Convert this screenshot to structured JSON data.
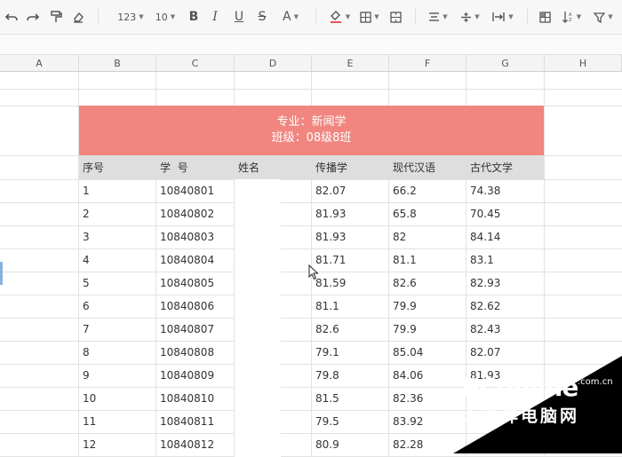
{
  "toolbar": {
    "number_format_label": "123",
    "font_size_label": "10",
    "bold_label": "B",
    "italic_label": "I",
    "underline_label": "U",
    "strike_label": "S",
    "font_color_label": "A"
  },
  "columns": [
    "A",
    "B",
    "C",
    "D",
    "E",
    "F",
    "G",
    "H"
  ],
  "banner": {
    "line1": "专业：新闻学",
    "line2": "班级：08级8班"
  },
  "table": {
    "headers": [
      "序号",
      "学  号",
      "姓名",
      "传播学",
      "现代汉语",
      "古代文学"
    ],
    "rows": [
      [
        "1",
        "10840801",
        "",
        "82.07",
        "66.2",
        "74.38"
      ],
      [
        "2",
        "10840802",
        "",
        "81.93",
        "65.8",
        "70.45"
      ],
      [
        "3",
        "10840803",
        "",
        "81.93",
        "82",
        "84.14"
      ],
      [
        "4",
        "10840804",
        "",
        "81.71",
        "81.1",
        "83.1"
      ],
      [
        "5",
        "10840805",
        "",
        "81.59",
        "82.6",
        "82.93"
      ],
      [
        "6",
        "10840806",
        "",
        "81.1",
        "79.9",
        "82.62"
      ],
      [
        "7",
        "10840807",
        "",
        "82.6",
        "79.9",
        "82.43"
      ],
      [
        "8",
        "10840808",
        "",
        "79.1",
        "85.04",
        "82.07"
      ],
      [
        "9",
        "10840809",
        "",
        "79.8",
        "84.06",
        "81.93"
      ],
      [
        "10",
        "10840810",
        "",
        "81.5",
        "82.36",
        ""
      ],
      [
        "11",
        "10840811",
        "",
        "79.5",
        "83.92",
        ""
      ],
      [
        "12",
        "10840812",
        "",
        "80.9",
        "82.28",
        ""
      ]
    ]
  },
  "watermark": {
    "brand": "PConline",
    "domain": ".com.cn",
    "cn_name": "太平洋电脑网"
  },
  "colors": {
    "banner": "#f0867f",
    "header_row": "#dedede",
    "watermark_bg": "#000000"
  }
}
